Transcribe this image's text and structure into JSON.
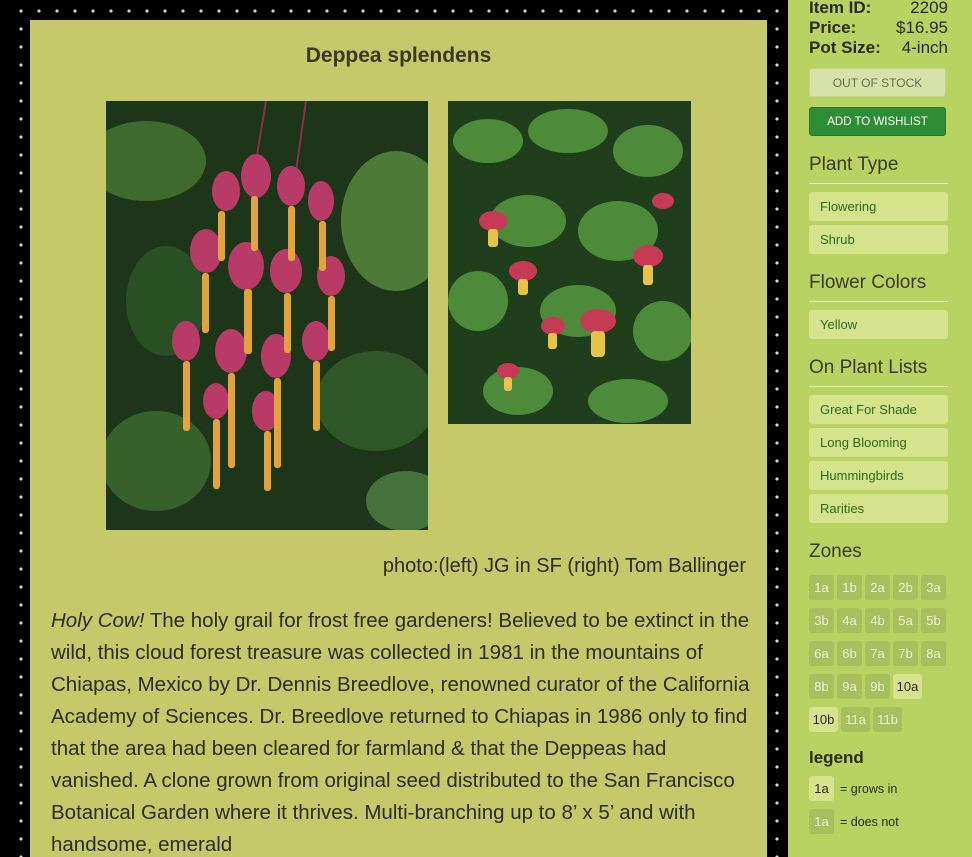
{
  "product": {
    "title": "Deppea splendens",
    "photo_credit": "photo:(left) JG in SF (right) Tom Ballinger",
    "description_lead": "Holy Cow!",
    "description_body": " The holy grail for frost free gardeners! Believed to be extinct in the wild, this cloud forest treasure was collected in 1981 in the mountains of Chiapas, Mexico by Dr. Dennis Breedlove, renowned curator of the California Academy of Sciences. Dr. Breedlove returned to Chiapas in 1986 only to find that the area had been cleared for farmland & that the Deppeas had vanished. A clone grown from original seed distributed to the San Francisco Botanical Garden where it thrives. Multi-branching up to 8’ x 5’ and with handsome, emerald"
  },
  "sidebar": {
    "item_id_label": "Item ID:",
    "item_id_value": "2209",
    "price_label": "Price:",
    "price_value": "$16.95",
    "pot_label": "Pot Size:",
    "pot_value": "4-inch",
    "out_of_stock_label": "OUT OF STOCK",
    "wishlist_label": "ADD TO WISHLIST",
    "plant_type_title": "Plant Type",
    "plant_types": [
      "Flowering",
      "Shrub"
    ],
    "flower_colors_title": "Flower Colors",
    "flower_colors": [
      "Yellow"
    ],
    "plant_lists_title": "On Plant Lists",
    "plant_lists": [
      "Great For Shade",
      "Long Blooming",
      "Hummingbirds",
      "Rarities"
    ],
    "zones_title": "Zones",
    "zones": [
      {
        "label": "1a",
        "grows": false
      },
      {
        "label": "1b",
        "grows": false
      },
      {
        "label": "2a",
        "grows": false
      },
      {
        "label": "2b",
        "grows": false
      },
      {
        "label": "3a",
        "grows": false
      },
      {
        "label": "3b",
        "grows": false
      },
      {
        "label": "4a",
        "grows": false
      },
      {
        "label": "4b",
        "grows": false
      },
      {
        "label": "5a",
        "grows": false
      },
      {
        "label": "5b",
        "grows": false
      },
      {
        "label": "6a",
        "grows": false
      },
      {
        "label": "6b",
        "grows": false
      },
      {
        "label": "7a",
        "grows": false
      },
      {
        "label": "7b",
        "grows": false
      },
      {
        "label": "8a",
        "grows": false
      },
      {
        "label": "8b",
        "grows": false
      },
      {
        "label": "9a",
        "grows": false
      },
      {
        "label": "9b",
        "grows": false
      },
      {
        "label": "10a",
        "grows": true
      },
      {
        "label": "10b",
        "grows": true
      },
      {
        "label": "11a",
        "grows": false
      },
      {
        "label": "11b",
        "grows": false
      }
    ],
    "legend_title": "legend",
    "legend_grows_zone": "1a",
    "legend_grows_text": "= grows in",
    "legend_not_zone": "1a",
    "legend_not_text": "= does not"
  },
  "colors": {
    "content_bg": "#c6c96a",
    "sidebar_bg": "#b9d362",
    "wishlist_button": "#2f8d35"
  }
}
